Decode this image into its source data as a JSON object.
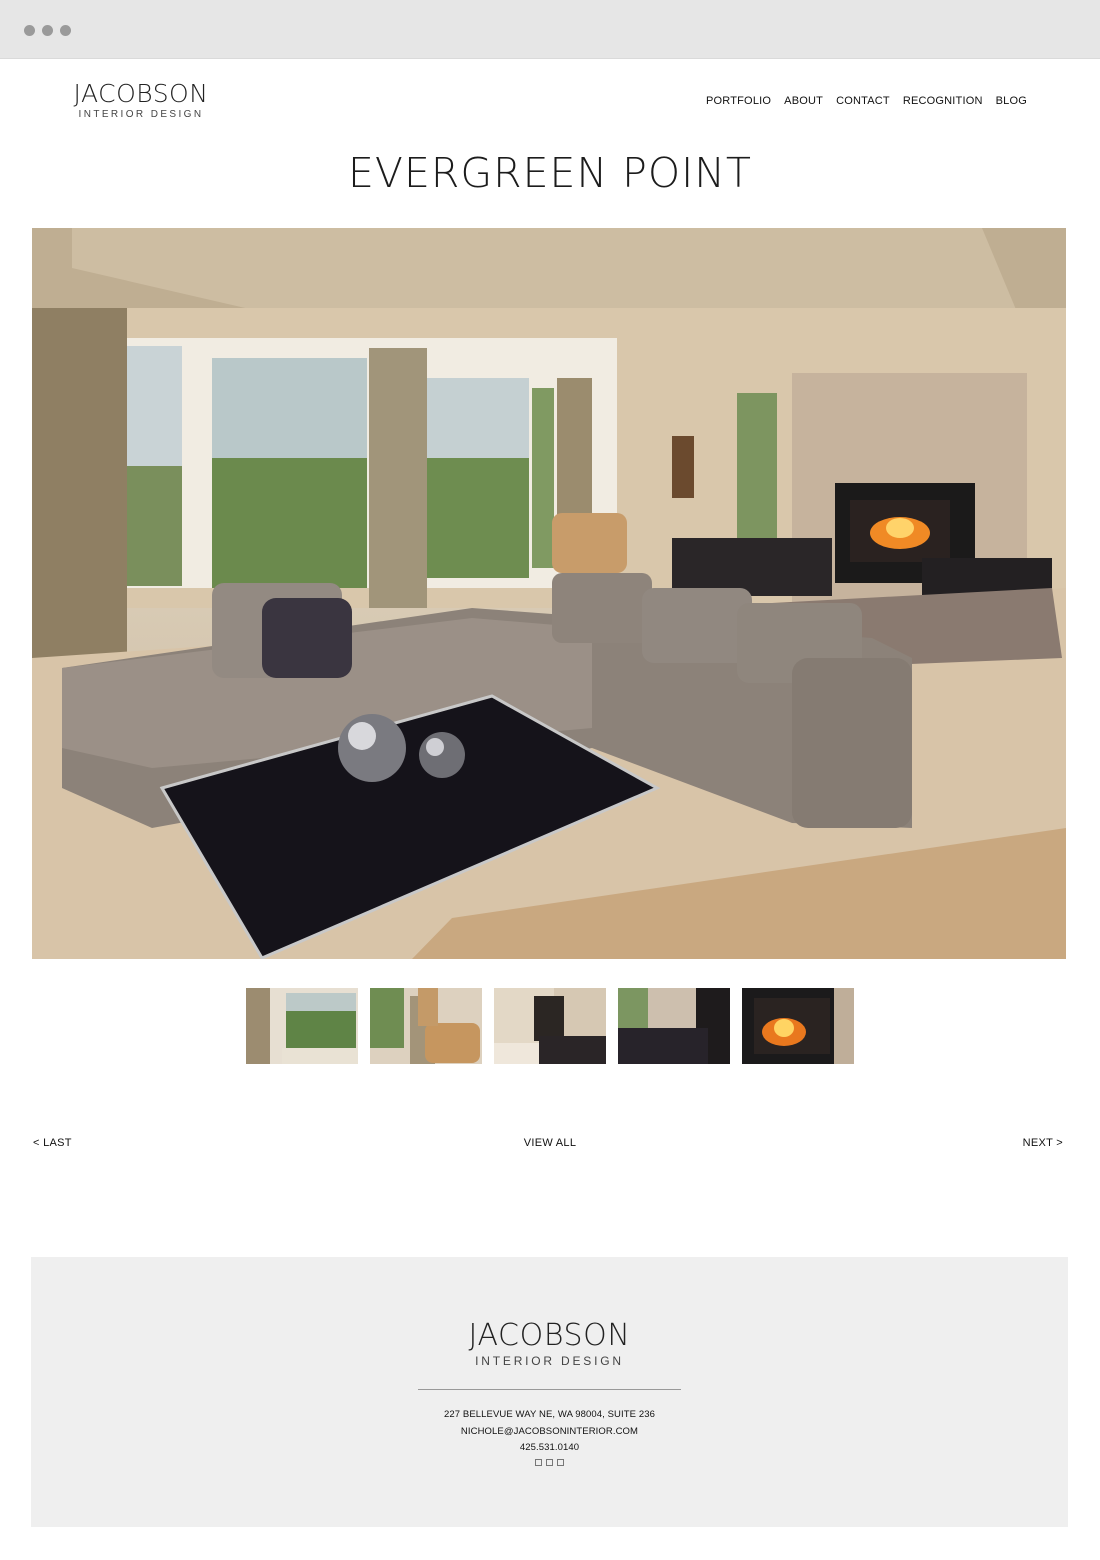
{
  "header": {
    "logo_name": "JACOBSON",
    "logo_tagline": "INTERIOR DESIGN",
    "nav": [
      "PORTFOLIO",
      "ABOUT",
      "CONTACT",
      "RECOGNITION",
      "BLOG"
    ]
  },
  "project": {
    "title": "EVERGREEN POINT"
  },
  "gallery": {
    "thumbnail_count": 5
  },
  "pager": {
    "prev": "< LAST",
    "view_all": "VIEW ALL",
    "next": "NEXT >"
  },
  "footer": {
    "logo_name": "JACOBSON",
    "logo_tagline": "INTERIOR DESIGN",
    "address": "227 BELLEVUE WAY NE, WA 98004, SUITE 236",
    "email": "NICHOLE@JACOBSONINTERIOR.COM",
    "phone": "425.531.0140",
    "social_icons": [
      "social-icon-1",
      "social-icon-2",
      "social-icon-3"
    ]
  },
  "colors": {
    "footer_bg": "#efefef",
    "chrome_bg": "#e6e6e6"
  }
}
